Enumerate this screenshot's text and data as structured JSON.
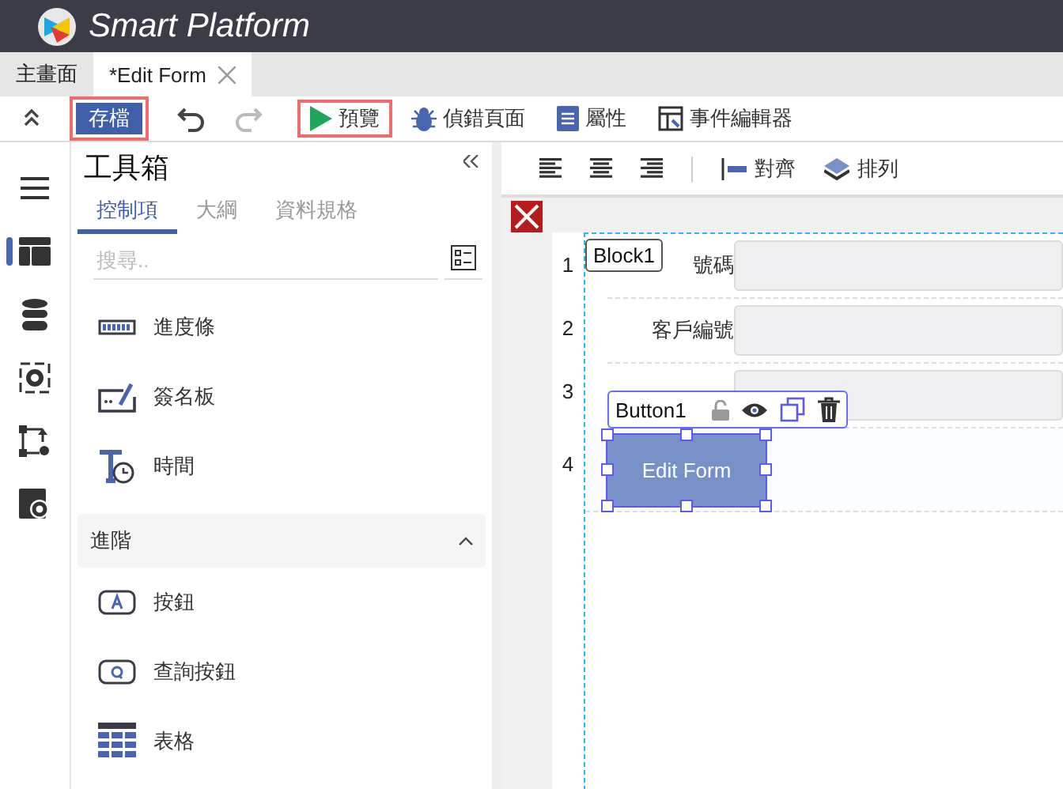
{
  "app": {
    "title": "Smart Platform"
  },
  "tabs": [
    {
      "label": "主畫面",
      "selected": false,
      "closable": false
    },
    {
      "label": "*Edit Form",
      "selected": true,
      "closable": true
    }
  ],
  "toolbar": {
    "items": [
      {
        "kind": "collapse"
      },
      {
        "kind": "save",
        "label": "存檔",
        "highlighted": true
      },
      {
        "kind": "undo",
        "disabled": false
      },
      {
        "kind": "redo",
        "disabled": true
      },
      {
        "kind": "preview",
        "label": "預覽",
        "highlighted": true
      },
      {
        "kind": "debug",
        "label": "偵錯頁面",
        "highlighted": false
      },
      {
        "kind": "properties",
        "label": "屬性",
        "highlighted": false
      },
      {
        "kind": "events",
        "label": "事件編輯器",
        "highlighted": false
      }
    ]
  },
  "rail": [
    {
      "kind": "menu",
      "selected": false
    },
    {
      "kind": "layout",
      "selected": true
    },
    {
      "kind": "database",
      "selected": false
    },
    {
      "kind": "settings",
      "selected": false
    },
    {
      "kind": "flow",
      "selected": false
    },
    {
      "kind": "config",
      "selected": false
    }
  ],
  "toolbox": {
    "title": "工具箱",
    "subtabs": [
      {
        "label": "控制項",
        "selected": true
      },
      {
        "label": "大綱",
        "selected": false
      },
      {
        "label": "資料規格",
        "selected": false
      }
    ],
    "search": {
      "placeholder": "搜尋.."
    },
    "items": [
      {
        "kind": "progress",
        "label": "進度條"
      },
      {
        "kind": "signature",
        "label": "簽名板"
      },
      {
        "kind": "time",
        "label": "時間"
      }
    ],
    "section": {
      "label": "進階",
      "expanded": true,
      "items": [
        {
          "kind": "button",
          "label": "按鈕"
        },
        {
          "kind": "query",
          "label": "查詢按鈕"
        },
        {
          "kind": "table",
          "label": "表格"
        }
      ]
    }
  },
  "canvas_toolbar": {
    "items": [
      {
        "kind": "align-left"
      },
      {
        "kind": "align-center"
      },
      {
        "kind": "align-right"
      },
      {
        "kind": "align",
        "label": "對齊"
      },
      {
        "kind": "arrange",
        "label": "排列"
      }
    ]
  },
  "form": {
    "block_label": "Block1",
    "rows": [
      {
        "number": "1",
        "label": "號碼",
        "kind": "field"
      },
      {
        "number": "2",
        "label": "客戶編號",
        "kind": "field"
      },
      {
        "number": "3",
        "kind": "field"
      },
      {
        "number": "4",
        "kind": "button"
      }
    ],
    "button": {
      "name": "Button1",
      "text": "Edit Form",
      "selected": true
    }
  }
}
